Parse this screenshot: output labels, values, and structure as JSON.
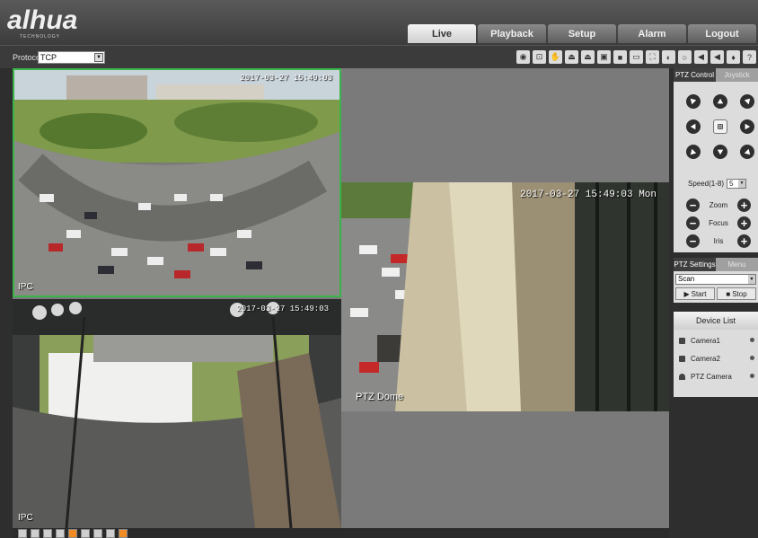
{
  "brand": {
    "logo": "alhua",
    "tagline": "TECHNOLOGY"
  },
  "nav_tabs": [
    {
      "label": "Live",
      "active": true
    },
    {
      "label": "Playback",
      "active": false
    },
    {
      "label": "Setup",
      "active": false
    },
    {
      "label": "Alarm",
      "active": false
    },
    {
      "label": "Logout",
      "active": false
    }
  ],
  "toolbar": {
    "protocol_label": "Protocol",
    "protocol_value": "TCP",
    "icons": [
      "snapshot-icon",
      "zoom-icon",
      "hand-icon",
      "record-icon",
      "record2-icon",
      "image-icon",
      "ratio-icon",
      "window-icon",
      "fullscreen-icon",
      "camera-icon",
      "circle-icon",
      "audio-icon",
      "speaker-icon",
      "mic-icon",
      "help-icon"
    ]
  },
  "video": {
    "panes": [
      {
        "timestamp": "2017-03-27 15:49:03",
        "channel": "IPC"
      },
      {
        "timestamp": "2017-03-27 15:49:03 Mon",
        "channel": "PTZ Dome"
      },
      {
        "timestamp": "2017-03-27 15:49:03",
        "channel": "IPC"
      }
    ]
  },
  "layout_buttons": [
    "home",
    "split1",
    "split4",
    "split6",
    "split8",
    "split9",
    "split13",
    "split16",
    "split25"
  ],
  "ptz": {
    "tab_control": "PTZ Control",
    "tab_joystick": "Joystick",
    "speed_label": "Speed(1-8)",
    "speed_value": "5",
    "zoom_label": "Zoom",
    "focus_label": "Focus",
    "iris_label": "Iris"
  },
  "ptz_settings": {
    "tab_settings": "PTZ Settings",
    "tab_menu": "Menu",
    "mode_value": "Scan",
    "start_label": "Start",
    "stop_label": "Stop"
  },
  "device_list": {
    "title": "Device List",
    "items": [
      "Camera1",
      "Camera2",
      "PTZ Camera"
    ]
  }
}
